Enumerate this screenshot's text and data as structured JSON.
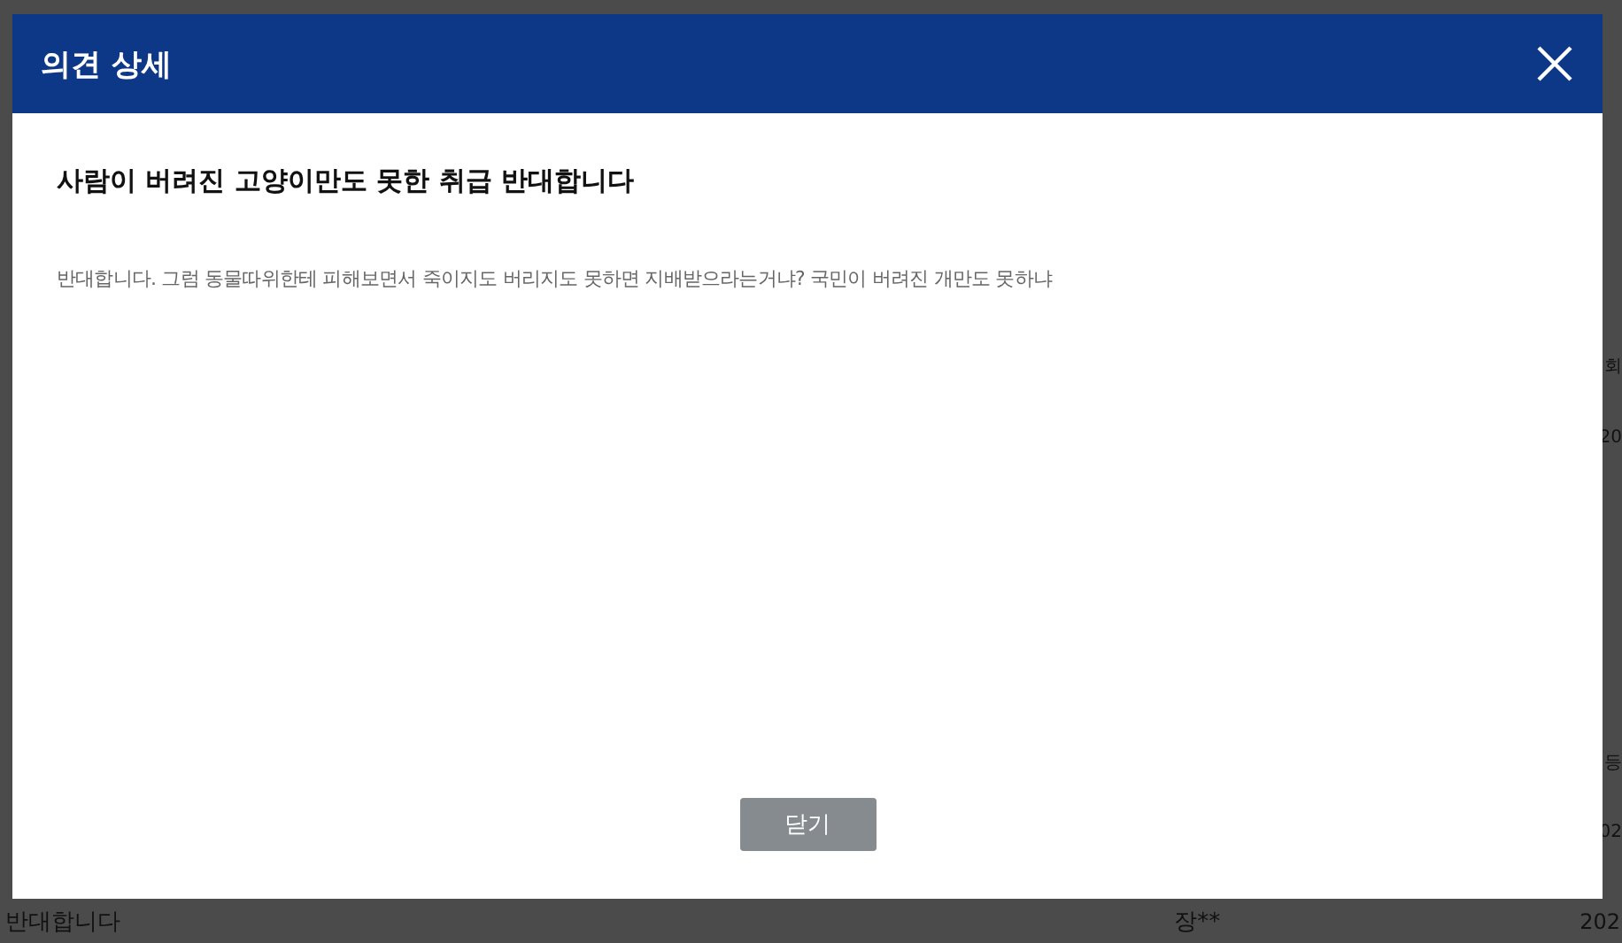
{
  "background_page": {
    "right_edge_fragments": [
      "회",
      "20",
      "등",
      "02"
    ],
    "bottom_row": {
      "opinion": "반대합니다",
      "author": "장**",
      "date": "202"
    }
  },
  "modal": {
    "title": "의견 상세",
    "subject": "사람이 버려진 고양이만도 못한 취급 반대합니다",
    "content": "반대합니다. 그럼 동물따위한테 피해보면서 죽이지도 버리지도 못하면 지배받으라는거냐? 국민이 버려진 개만도 못하냐",
    "buttons": [
      "닫기"
    ]
  }
}
